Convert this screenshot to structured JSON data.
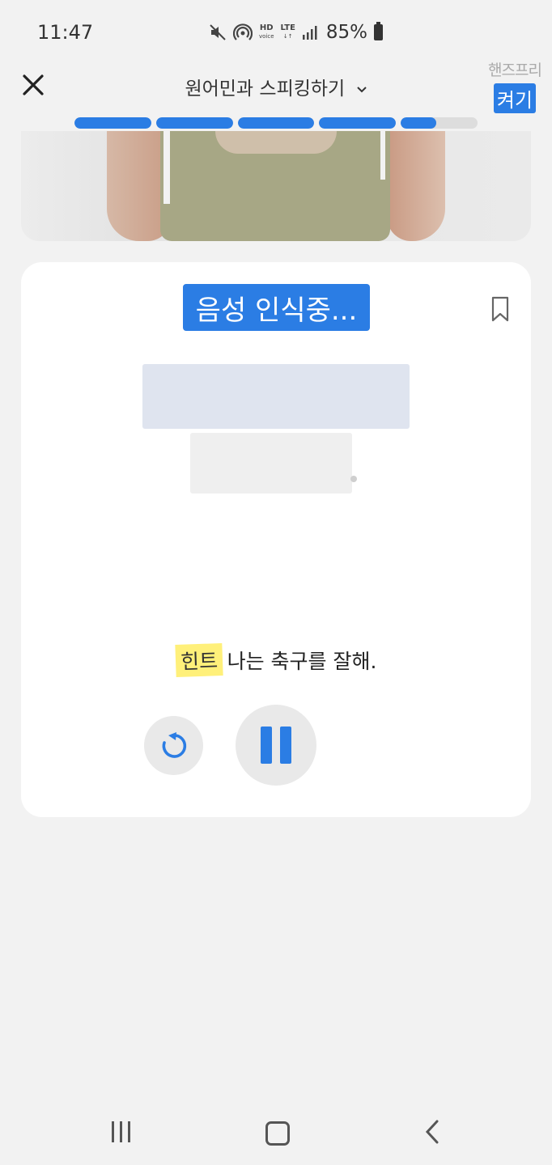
{
  "status_bar": {
    "time": "11:47",
    "hd_label": "HD",
    "voice_label": "voice",
    "lte_label": "LTE",
    "battery": "85%"
  },
  "header": {
    "title": "원어민과 스피킹하기",
    "handsfree_label": "핸즈프리",
    "handsfree_toggle": "켜기"
  },
  "progress": {
    "segments": [
      1,
      1,
      1,
      1,
      0.46
    ],
    "accent": "#2b7de4",
    "track": "#dddddd"
  },
  "card": {
    "status_badge": "음성 인식중...",
    "hint_tag": "힌트",
    "hint_text": "나는 축구를 잘해."
  },
  "icons": {
    "close": "close-icon",
    "dropdown": "chevron-down-icon",
    "bookmark": "bookmark-icon",
    "replay": "replay-icon",
    "pause": "pause-icon"
  },
  "nav": {
    "items": [
      "recent-apps",
      "home",
      "back"
    ]
  }
}
